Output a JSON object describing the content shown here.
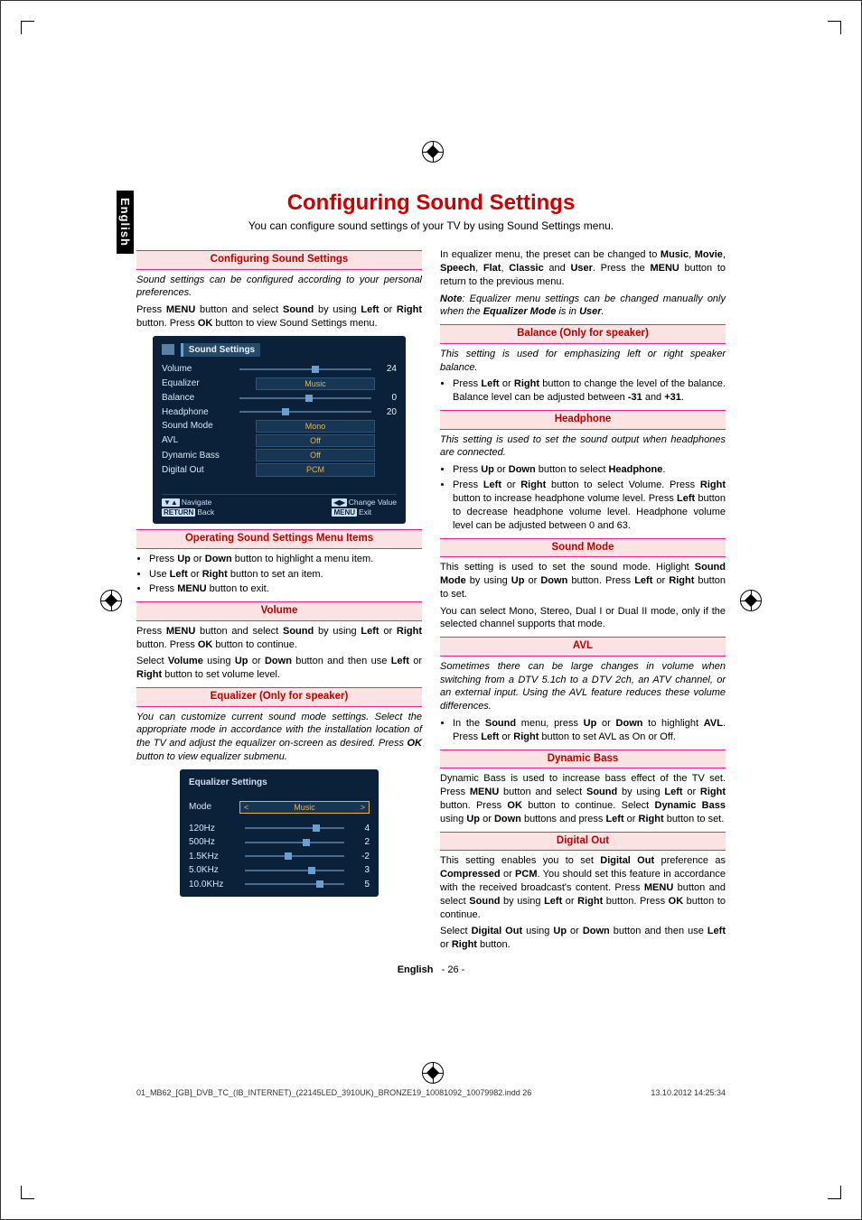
{
  "language_tab": "English",
  "title": "Configuring Sound Settings",
  "subtitle": "You can configure sound settings of your TV by using Sound Settings menu.",
  "left": {
    "h_conf": "Configuring Sound Settings",
    "conf_it": "Sound settings can be configured according to your personal preferences.",
    "conf_p": "Press MENU button and select Sound by using Left or Right button. Press OK button to view Sound Settings menu.",
    "h_op": "Operating Sound Settings Menu Items",
    "op1": "Press Up or Down button to highlight a menu item.",
    "op2": "Use Left or Right button to set an item.",
    "op3": "Press MENU button to exit.",
    "h_vol": "Volume",
    "vol_p1": "Press MENU button and select Sound by using Left or Right button. Press OK button to continue.",
    "vol_p2": "Select Volume using Up or Down button and then use Left or Right button to set volume level.",
    "h_eq": "Equalizer (Only for speaker)",
    "eq_it": "You can customize current sound mode settings. Select the appropriate mode in accordance with the installation location of the TV and adjust the equalizer on-screen as desired. Press OK button to view equalizer submenu."
  },
  "right": {
    "eq_p": "In equalizer menu, the preset can be changed to Music, Movie, Speech, Flat, Classic and User. Press the MENU button to return to the previous menu.",
    "eq_note": "Note: Equalizer menu settings can be changed manually only when the Equalizer Mode is in User.",
    "h_bal": "Balance (Only for speaker)",
    "bal_it": "This setting is used for emphasizing left or right speaker balance.",
    "bal_li": "Press Left or Right button to change the level of the balance. Balance level can be adjusted between -31 and +31.",
    "h_hp": "Headphone",
    "hp_it": "This setting is used to set the sound output when headphones are connected.",
    "hp_li1": "Press Up or Down button to select Headphone.",
    "hp_li2": "Press Left or Right button to select Volume. Press Right button to increase headphone volume level. Press Left button to decrease headphone volume level. Headphone volume level can be adjusted between 0 and 63.",
    "h_sm": "Sound Mode",
    "sm_p1": "This setting is used to set the sound mode. Higlight Sound Mode by using Up or Down button. Press Left or Right button to set.",
    "sm_p2": "You can select Mono, Stereo, Dual I or Dual II mode, only if the selected channel supports that mode.",
    "h_avl": "AVL",
    "avl_it": "Sometimes there can be large changes in volume when switching from a DTV 5.1ch to a DTV 2ch, an ATV channel, or an external input. Using the AVL feature reduces these volume differences.",
    "avl_li": "In the Sound menu, press Up or Down to highlight AVL. Press Left or Right button to set AVL as On or Off.",
    "h_db": "Dynamic Bass",
    "db_p": "Dynamic Bass is used to increase bass effect of the TV set. Press MENU button and select Sound by using Left or Right button. Press OK button to continue. Select Dynamic Bass using Up or Down buttons and press Left or Right button to set.",
    "h_do": "Digital Out",
    "do_p1": "This setting enables you to set Digital Out preference as Compressed or PCM. You should set this feature in accordance with the received broadcast's content. Press MENU button and select Sound by using Left or Right button. Press OK button to continue.",
    "do_p2": "Select Digital Out using Up or Down button and then use Left or Right button."
  },
  "osd_sound": {
    "title": "Sound Settings",
    "rows": [
      {
        "label": "Volume",
        "type": "bar",
        "pos": 55,
        "val": "24"
      },
      {
        "label": "Equalizer",
        "type": "sel",
        "val": "Music"
      },
      {
        "label": "Balance",
        "type": "bar",
        "pos": 50,
        "val": "0"
      },
      {
        "label": "Headphone",
        "type": "bar",
        "pos": 32,
        "val": "20"
      },
      {
        "label": "Sound Mode",
        "type": "sel",
        "val": "Mono"
      },
      {
        "label": "AVL",
        "type": "sel",
        "val": "Off"
      },
      {
        "label": "Dynamic Bass",
        "type": "sel",
        "val": "Off"
      },
      {
        "label": "Digital Out",
        "type": "sel",
        "val": "PCM"
      }
    ],
    "foot_nav": "Navigate",
    "foot_back": "Back",
    "foot_chg": "Change Value",
    "foot_exit": "Exit"
  },
  "osd_eq": {
    "title": "Equalizer Settings",
    "mode_label": "Mode",
    "mode_val": "Music",
    "bands": [
      {
        "label": "120Hz",
        "pos": 68,
        "val": "4"
      },
      {
        "label": "500Hz",
        "pos": 58,
        "val": "2"
      },
      {
        "label": "1.5KHz",
        "pos": 40,
        "val": "-2"
      },
      {
        "label": "5.0KHz",
        "pos": 64,
        "val": "3"
      },
      {
        "label": "10.0KHz",
        "pos": 72,
        "val": "5"
      }
    ]
  },
  "footer": {
    "lang": "English",
    "page": "- 26 -"
  },
  "print": {
    "left": "01_MB62_[GB]_DVB_TC_(IB_INTERNET)_(22145LED_3910UK)_BRONZE19_10081092_10079982.indd   26",
    "right": "13.10.2012   14:25:34"
  }
}
